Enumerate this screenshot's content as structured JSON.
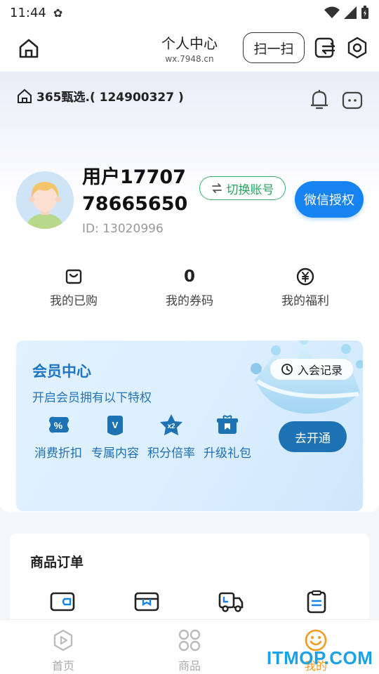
{
  "status_bar": {
    "time": "11:44"
  },
  "header": {
    "title": "个人中心",
    "subtitle": "wx.7948.cn",
    "scan_label": "扫一扫"
  },
  "shop": {
    "name": "365甄选.( 124900327 )"
  },
  "user": {
    "name": "用户1770778665650",
    "id_text": "ID: 13020996",
    "switch_label": "切换账号",
    "wechat_label": "微信授权"
  },
  "stats": [
    {
      "label": "我的已购",
      "icon": "bag-icon"
    },
    {
      "value": "0",
      "label": "我的券码"
    },
    {
      "label": "我的福利",
      "icon": "yen-icon"
    }
  ],
  "member": {
    "title": "会员中心",
    "subtitle": "开启会员拥有以下特权",
    "record_label": "入会记录",
    "open_label": "去开通",
    "perks": [
      {
        "label": "消费折扣",
        "icon": "discount-icon",
        "glyph": "%"
      },
      {
        "label": "专属内容",
        "icon": "vip-content-icon",
        "glyph": "V"
      },
      {
        "label": "积分倍率",
        "icon": "points-multiplier-icon",
        "glyph": "x2"
      },
      {
        "label": "升级礼包",
        "icon": "gift-icon",
        "glyph": ""
      }
    ]
  },
  "orders": {
    "title": "商品订单",
    "icons": [
      "wallet-icon",
      "box-icon",
      "truck-icon",
      "clipboard-icon"
    ]
  },
  "tabs": [
    {
      "label": "首页",
      "icon": "play-icon",
      "active": false
    },
    {
      "label": "商品",
      "icon": "grid-icon",
      "active": false
    },
    {
      "label": "我的",
      "icon": "smile-icon",
      "active": true
    }
  ],
  "watermark": "ITMOP.COM",
  "colors": {
    "accent_blue": "#1683f0",
    "member_blue": "#1d72b4",
    "switch_green": "#2aa35d",
    "active_tab": "#f39a1f"
  }
}
